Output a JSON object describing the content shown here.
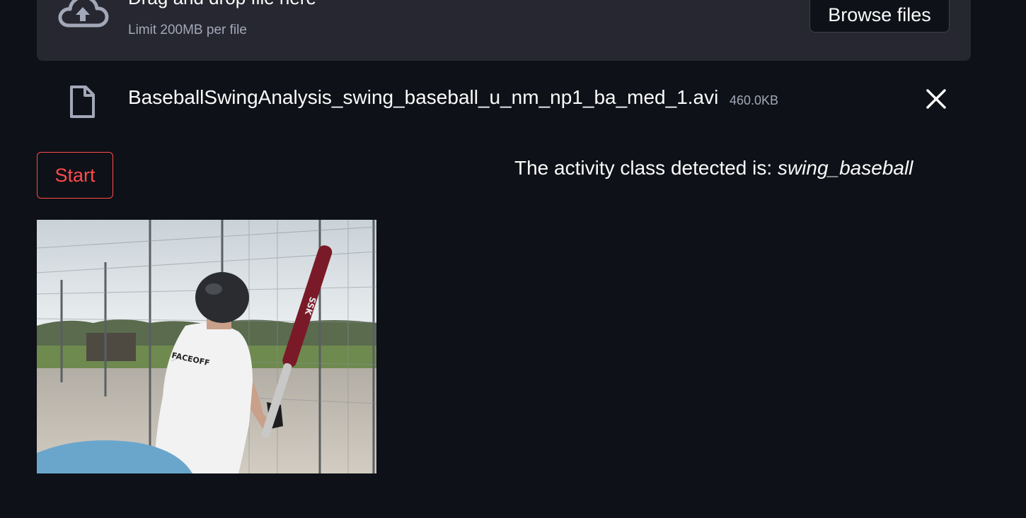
{
  "uploader": {
    "drop_title": "Drag and drop file here",
    "limit_text": "Limit 200MB per file",
    "browse_label": "Browse files",
    "upload_icon": "cloud-upload-icon"
  },
  "uploaded_file": {
    "file_icon": "file-icon",
    "name": "BaseballSwingAnalysis_swing_baseball_u_nm_np1_ba_med_1.avi",
    "size": "460.0KB",
    "remove_icon": "close-icon"
  },
  "actions": {
    "start_label": "Start"
  },
  "result": {
    "prefix": "The activity class detected is: ",
    "activity_class": "swing_baseball"
  },
  "video_frame": {
    "shirt_text": "FACEOFF",
    "bat_text": "SSK"
  },
  "colors": {
    "background": "#0e1117",
    "panel": "#262730",
    "accent": "#ff4b4b",
    "muted_text": "#a3a8b8"
  }
}
